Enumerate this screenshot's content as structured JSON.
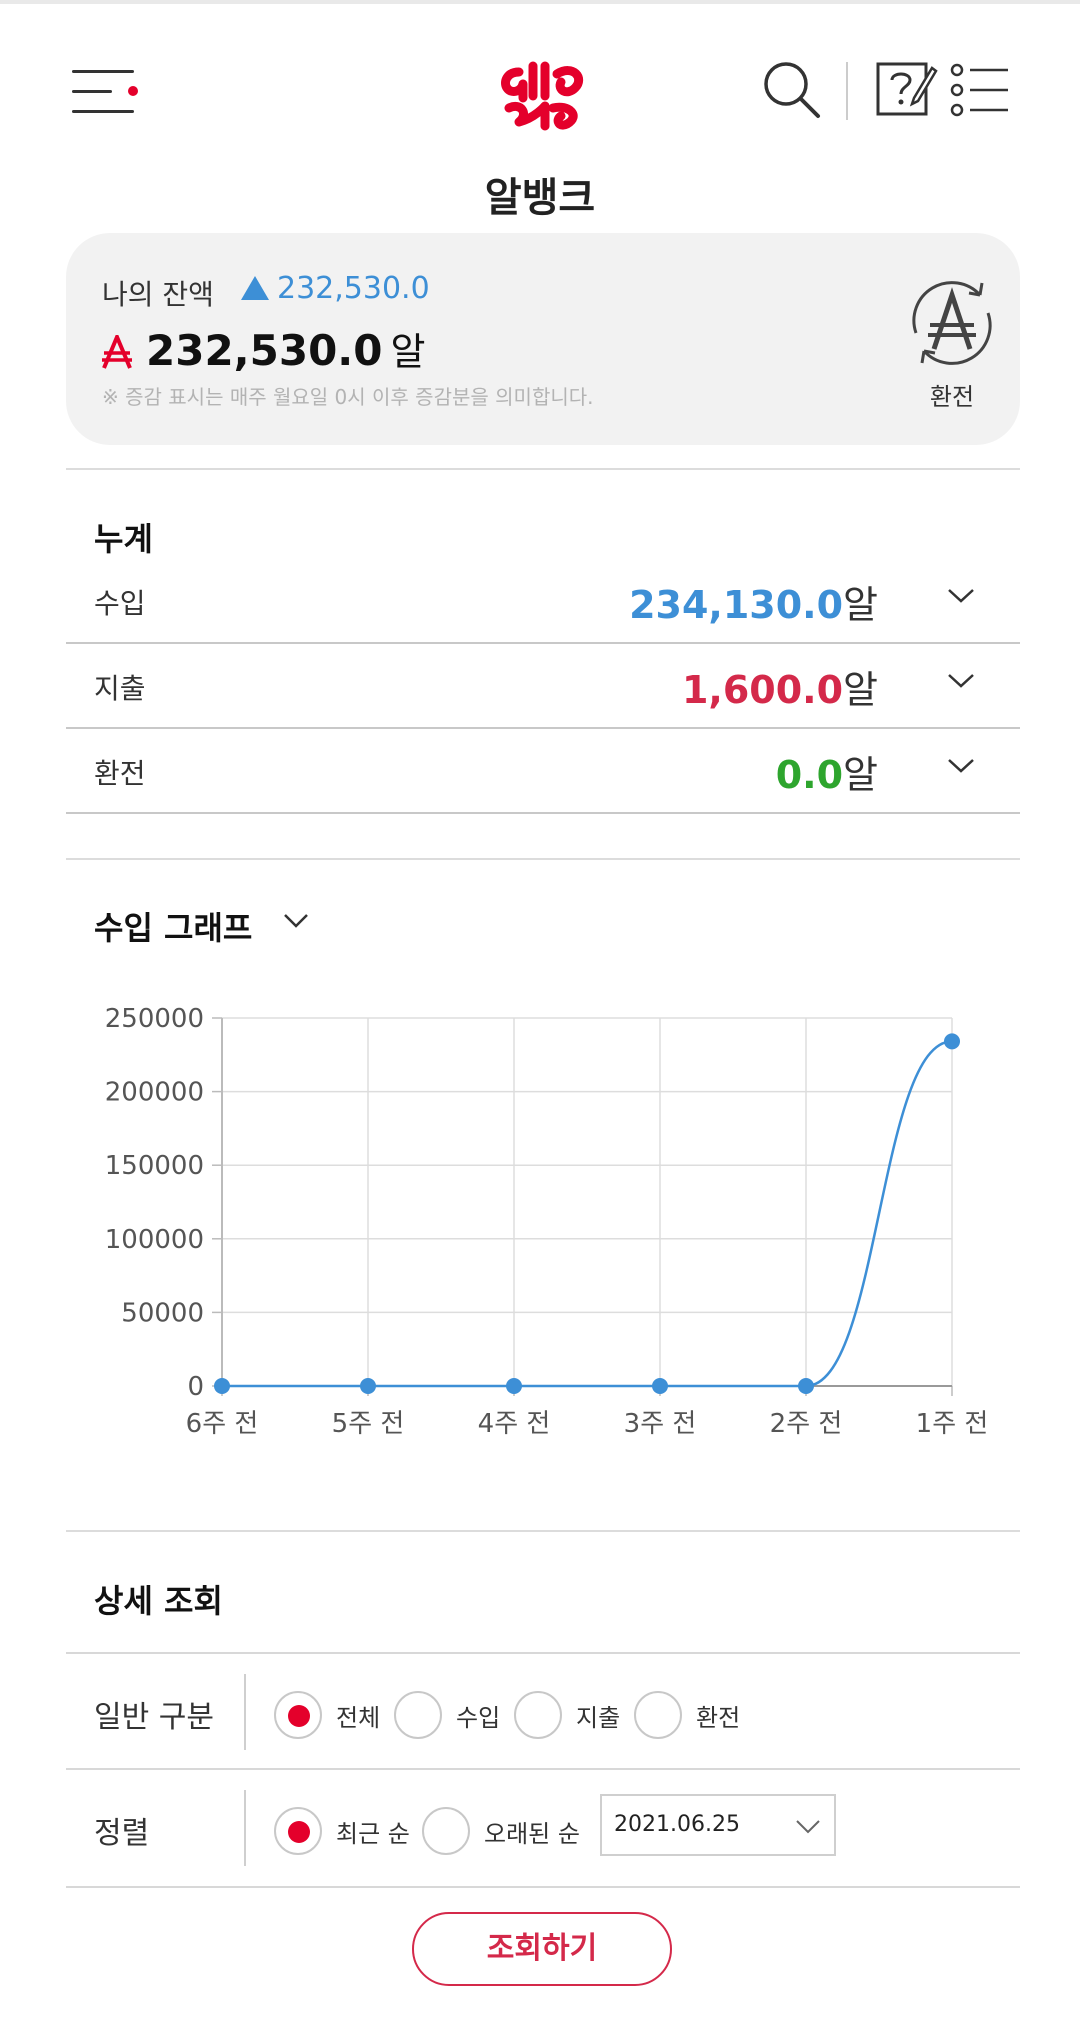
{
  "header": {
    "title": "알뱅크",
    "icons": [
      "menu-icon",
      "logo",
      "search-icon",
      "help-edit-icon",
      "list-icon"
    ],
    "accent_color": "#e4002b"
  },
  "balance": {
    "label": "나의 잔액",
    "change": "232,530.0",
    "amount": "232,530.0",
    "unit": "알",
    "note": "※ 증감 표시는 매주 월요일 0시 이후 증감분을 의미합니다.",
    "exchange_label": "환전"
  },
  "summary": {
    "title": "누계",
    "rows": [
      {
        "label": "수입",
        "value": "234,130.0",
        "unit": "알",
        "color": "#3d8fd6"
      },
      {
        "label": "지출",
        "value": "1,600.0",
        "unit": "알",
        "color": "#d4294a"
      },
      {
        "label": "환전",
        "value": "0.0",
        "unit": "알",
        "color": "#2ea52e"
      }
    ]
  },
  "graph": {
    "title": "수입 그래프"
  },
  "chart_data": {
    "type": "line",
    "categories": [
      "6주 전",
      "5주 전",
      "4주 전",
      "3주 전",
      "2주 전",
      "1주 전"
    ],
    "values": [
      0,
      0,
      0,
      0,
      0,
      234130
    ],
    "y_ticks": [
      0,
      50000,
      100000,
      150000,
      200000,
      250000
    ],
    "ylim": [
      0,
      250000
    ],
    "grid": true,
    "line_color": "#3d8fd6"
  },
  "detail": {
    "title": "상세 조회",
    "category": {
      "label": "일반 구분",
      "options": [
        "전체",
        "수입",
        "지출",
        "환전"
      ],
      "selected": "전체"
    },
    "sort": {
      "label": "정렬",
      "options": [
        "최근 순",
        "오래된 순"
      ],
      "selected": "최근 순",
      "date": "2021.06.25"
    },
    "submit_label": "조회하기"
  }
}
